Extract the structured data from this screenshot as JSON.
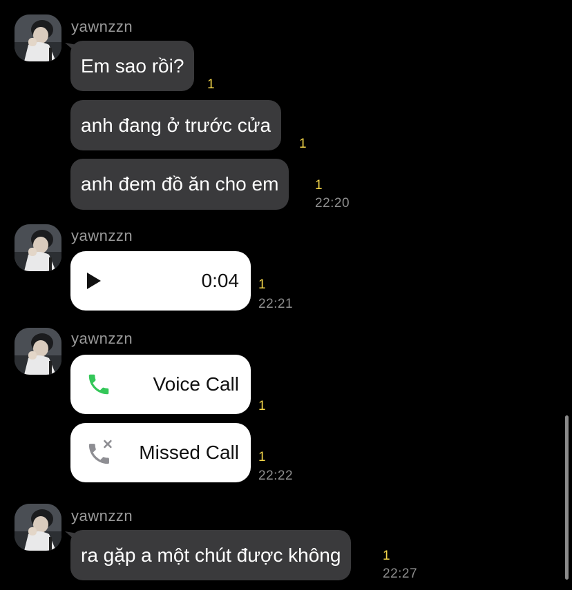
{
  "sender_name": "yawnzzn",
  "unread_mark": "1",
  "groups": [
    {
      "messages": [
        {
          "text": "Em sao rồi?"
        },
        {
          "text": "anh đang ở trước cửa"
        },
        {
          "text": "anh đem đồ ăn cho em",
          "time": "22:20"
        }
      ]
    },
    {
      "voice_message": {
        "duration": "0:04",
        "time": "22:21"
      }
    },
    {
      "calls": [
        {
          "label": "Voice Call",
          "icon": "phone-icon"
        },
        {
          "label": "Missed Call",
          "icon": "missed-call-icon",
          "time": "22:22"
        }
      ]
    },
    {
      "messages": [
        {
          "text": "ra gặp a một chút được không",
          "time": "22:27"
        }
      ]
    }
  ],
  "colors": {
    "background": "#000000",
    "bubble": "#3a3a3c",
    "card": "#ffffff",
    "unread": "#f3d54a",
    "call_green": "#34c759",
    "missed_gray": "#8e8e93"
  }
}
